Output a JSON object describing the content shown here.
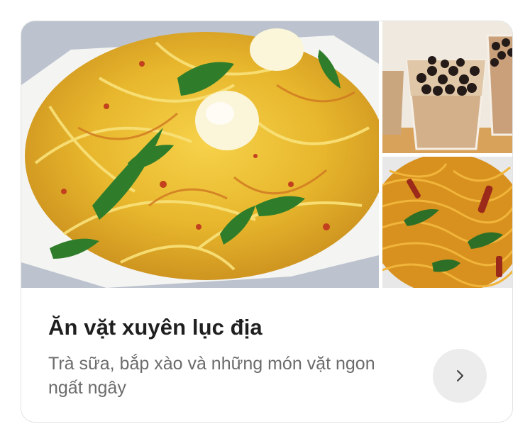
{
  "card": {
    "title": "Ăn vặt xuyên lục địa",
    "subtitle": "Trà sữa, bắp xào và những món vặt ngon ngất ngây",
    "images": [
      {
        "name": "green-papaya-salad-photo"
      },
      {
        "name": "bubble-milk-tea-photo"
      },
      {
        "name": "stir-fried-noodles-photo"
      }
    ],
    "arrow_icon": "chevron-right-icon"
  },
  "colors": {
    "title": "#1f1f1f",
    "subtitle": "#6b6b6b",
    "button_bg": "#ececec",
    "border": "#e3e3e3"
  }
}
